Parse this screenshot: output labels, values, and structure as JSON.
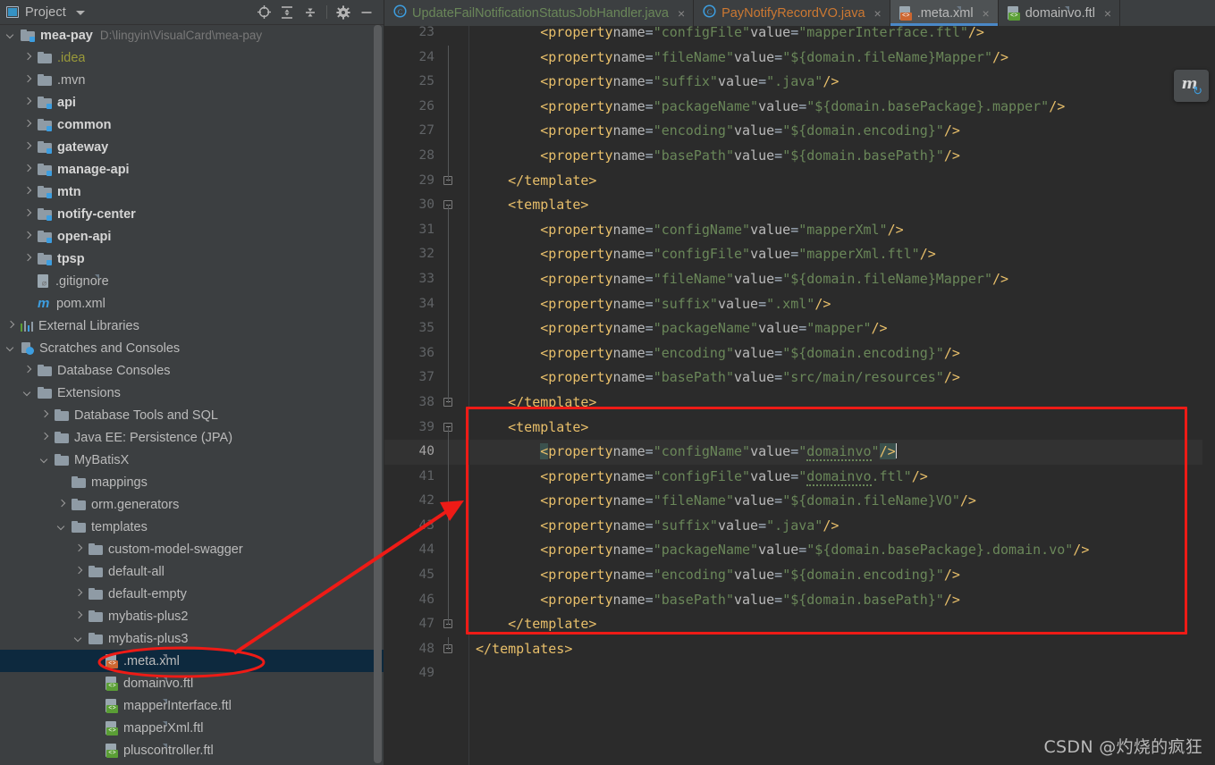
{
  "project_panel": {
    "title": "Project",
    "tools": [
      {
        "name": "locate-icon",
        "glyph": "locate"
      },
      {
        "name": "expand-all-icon",
        "glyph": "expand"
      },
      {
        "name": "collapse-all-icon",
        "glyph": "collapse"
      },
      {
        "name": "settings-gear-icon",
        "glyph": "gear"
      },
      {
        "name": "hide-icon",
        "glyph": "minus"
      }
    ],
    "tree": [
      {
        "indent": 0,
        "arrow": "down",
        "icon": "module-folder",
        "label": "mea-pay",
        "bold": true,
        "sub": "D:\\lingyin\\VisualCard\\mea-pay"
      },
      {
        "indent": 1,
        "arrow": "right",
        "icon": "folder",
        "label": ".idea",
        "excluded": true
      },
      {
        "indent": 1,
        "arrow": "right",
        "icon": "folder",
        "label": ".mvn"
      },
      {
        "indent": 1,
        "arrow": "right",
        "icon": "module-folder",
        "label": "api",
        "bold": true
      },
      {
        "indent": 1,
        "arrow": "right",
        "icon": "module-folder",
        "label": "common",
        "bold": true
      },
      {
        "indent": 1,
        "arrow": "right",
        "icon": "module-folder",
        "label": "gateway",
        "bold": true
      },
      {
        "indent": 1,
        "arrow": "right",
        "icon": "module-folder",
        "label": "manage-api",
        "bold": true
      },
      {
        "indent": 1,
        "arrow": "right",
        "icon": "module-folder",
        "label": "mtn",
        "bold": true
      },
      {
        "indent": 1,
        "arrow": "right",
        "icon": "module-folder",
        "label": "notify-center",
        "bold": true
      },
      {
        "indent": 1,
        "arrow": "right",
        "icon": "module-folder",
        "label": "open-api",
        "bold": true
      },
      {
        "indent": 1,
        "arrow": "right",
        "icon": "module-folder",
        "label": "tpsp",
        "bold": true
      },
      {
        "indent": 1,
        "arrow": "none",
        "icon": "gitignore-file",
        "label": ".gitignore"
      },
      {
        "indent": 1,
        "arrow": "none",
        "icon": "maven-file",
        "label": "pom.xml"
      },
      {
        "indent": 0,
        "arrow": "right",
        "icon": "library",
        "label": "External Libraries"
      },
      {
        "indent": 0,
        "arrow": "down",
        "icon": "scratch",
        "label": "Scratches and Consoles"
      },
      {
        "indent": 1,
        "arrow": "right",
        "icon": "folder",
        "label": "Database Consoles"
      },
      {
        "indent": 1,
        "arrow": "down",
        "icon": "folder",
        "label": "Extensions"
      },
      {
        "indent": 2,
        "arrow": "right",
        "icon": "folder",
        "label": "Database Tools and SQL"
      },
      {
        "indent": 2,
        "arrow": "right",
        "icon": "folder",
        "label": "Java EE: Persistence (JPA)"
      },
      {
        "indent": 2,
        "arrow": "down",
        "icon": "folder",
        "label": "MyBatisX"
      },
      {
        "indent": 3,
        "arrow": "none",
        "icon": "folder",
        "label": "mappings"
      },
      {
        "indent": 3,
        "arrow": "right",
        "icon": "folder",
        "label": "orm.generators"
      },
      {
        "indent": 3,
        "arrow": "down",
        "icon": "folder",
        "label": "templates"
      },
      {
        "indent": 4,
        "arrow": "right",
        "icon": "folder",
        "label": "custom-model-swagger"
      },
      {
        "indent": 4,
        "arrow": "right",
        "icon": "folder",
        "label": "default-all"
      },
      {
        "indent": 4,
        "arrow": "right",
        "icon": "folder",
        "label": "default-empty"
      },
      {
        "indent": 4,
        "arrow": "right",
        "icon": "folder",
        "label": "mybatis-plus2"
      },
      {
        "indent": 4,
        "arrow": "down",
        "icon": "folder",
        "label": "mybatis-plus3"
      },
      {
        "indent": 5,
        "arrow": "none",
        "icon": "xml-file",
        "label": ".meta.xml",
        "selected": true
      },
      {
        "indent": 5,
        "arrow": "none",
        "icon": "ftl-file",
        "label": "domainvo.ftl"
      },
      {
        "indent": 5,
        "arrow": "none",
        "icon": "ftl-file",
        "label": "mapperInterface.ftl"
      },
      {
        "indent": 5,
        "arrow": "none",
        "icon": "ftl-file",
        "label": "mapperXml.ftl"
      },
      {
        "indent": 5,
        "arrow": "none",
        "icon": "ftl-file",
        "label": "pluscontroller.ftl"
      }
    ]
  },
  "editor": {
    "tabs": [
      {
        "label": "UpdateFailNotificationStatusJobHandler.java",
        "icon": "java-class-icon",
        "color": "#6a8759",
        "active": false,
        "close": "×"
      },
      {
        "label": "PayNotifyRecordVO.java",
        "icon": "java-class-icon",
        "color": "#cc7832",
        "active": false,
        "close": "×"
      },
      {
        "label": ".meta.xml",
        "icon": "xml-file-icon",
        "color": "#b9b9b9",
        "active": true,
        "close": "×"
      },
      {
        "label": "domainvo.ftl",
        "icon": "ftl-file-icon",
        "color": "#b9b9b9",
        "active": false,
        "close": "×"
      }
    ],
    "current_line": 40,
    "lines": [
      {
        "n": 23,
        "fold": "none",
        "indent": 0,
        "clipped": true,
        "parts": [
          {
            "t": "<property ",
            "c": "tag"
          },
          {
            "t": "name",
            "c": "attr"
          },
          {
            "t": "=",
            "c": "eq"
          },
          {
            "t": "\"configFile\"",
            "c": "val"
          },
          {
            "t": " ",
            "c": "plain"
          },
          {
            "t": "value",
            "c": "attr"
          },
          {
            "t": "=",
            "c": "eq"
          },
          {
            "t": "\"mapperInterface.ftl\"",
            "c": "val"
          },
          {
            "t": "/>",
            "c": "tag"
          }
        ],
        "text": "        <property name=\"configFile\" value=\"mapperInterface.ftl\"/>"
      },
      {
        "n": 24,
        "fold": "line",
        "indent": 0,
        "text": "        <property name=\"fileName\" value=\"${domain.fileName}Mapper\"/>"
      },
      {
        "n": 25,
        "fold": "line",
        "indent": 0,
        "text": "        <property name=\"suffix\" value=\".java\"/>"
      },
      {
        "n": 26,
        "fold": "line",
        "indent": 0,
        "text": "        <property name=\"packageName\" value=\"${domain.basePackage}.mapper\"/>"
      },
      {
        "n": 27,
        "fold": "line",
        "indent": 0,
        "text": "        <property name=\"encoding\" value=\"${domain.encoding}\"/>"
      },
      {
        "n": 28,
        "fold": "line",
        "indent": 0,
        "text": "        <property name=\"basePath\" value=\"${domain.basePath}\"/>"
      },
      {
        "n": 29,
        "fold": "end",
        "indent": 0,
        "text": "    </template>"
      },
      {
        "n": 30,
        "fold": "start",
        "indent": 0,
        "text": "    <template>"
      },
      {
        "n": 31,
        "fold": "line",
        "indent": 0,
        "text": "        <property name=\"configName\" value=\"mapperXml\"/>"
      },
      {
        "n": 32,
        "fold": "line",
        "indent": 0,
        "text": "        <property name=\"configFile\" value=\"mapperXml.ftl\"/>"
      },
      {
        "n": 33,
        "fold": "line",
        "indent": 0,
        "text": "        <property name=\"fileName\" value=\"${domain.fileName}Mapper\"/>"
      },
      {
        "n": 34,
        "fold": "line",
        "indent": 0,
        "text": "        <property name=\"suffix\" value=\".xml\"/>"
      },
      {
        "n": 35,
        "fold": "line",
        "indent": 0,
        "text": "        <property name=\"packageName\" value=\"mapper\"/>"
      },
      {
        "n": 36,
        "fold": "line",
        "indent": 0,
        "text": "        <property name=\"encoding\" value=\"${domain.encoding}\"/>"
      },
      {
        "n": 37,
        "fold": "line",
        "indent": 0,
        "text": "        <property name=\"basePath\" value=\"src/main/resources\"/>"
      },
      {
        "n": 38,
        "fold": "end",
        "indent": 0,
        "text": "    </template>"
      },
      {
        "n": 39,
        "fold": "start",
        "indent": 0,
        "text": "    <template>"
      },
      {
        "n": 40,
        "fold": "line",
        "indent": 0,
        "current": true,
        "text": "        <property name=\"configName\" value=\"domainvo\"/>"
      },
      {
        "n": 41,
        "fold": "line",
        "indent": 0,
        "text": "        <property name=\"configFile\" value=\"domainvo.ftl\"/>"
      },
      {
        "n": 42,
        "fold": "line",
        "indent": 0,
        "text": "        <property name=\"fileName\" value=\"${domain.fileName}VO\"/>"
      },
      {
        "n": 43,
        "fold": "line",
        "indent": 0,
        "text": "        <property name=\"suffix\" value=\".java\"/>"
      },
      {
        "n": 44,
        "fold": "line",
        "indent": 0,
        "text": "        <property name=\"packageName\" value=\"${domain.basePackage}.domain.vo\"/>"
      },
      {
        "n": 45,
        "fold": "line",
        "indent": 0,
        "text": "        <property name=\"encoding\" value=\"${domain.encoding}\"/>"
      },
      {
        "n": 46,
        "fold": "line",
        "indent": 0,
        "text": "        <property name=\"basePath\" value=\"${domain.basePath}\"/>"
      },
      {
        "n": 47,
        "fold": "end",
        "indent": 0,
        "text": "    </template>"
      },
      {
        "n": 48,
        "fold": "end",
        "indent": 0,
        "text": "</templates>"
      },
      {
        "n": 49,
        "fold": "none",
        "indent": 0,
        "text": ""
      }
    ],
    "maven_reload": {
      "letter": "m",
      "sync_glyph": "↻"
    }
  },
  "annotations": {
    "highlight_box_label": "template-block-highlight",
    "ellipse_label": "meta-xml-ellipse",
    "arrow_label": "meta-xml-to-template-arrow",
    "color": "#ee1b16"
  },
  "watermark": {
    "text": "CSDN @灼烧的疯狂"
  }
}
